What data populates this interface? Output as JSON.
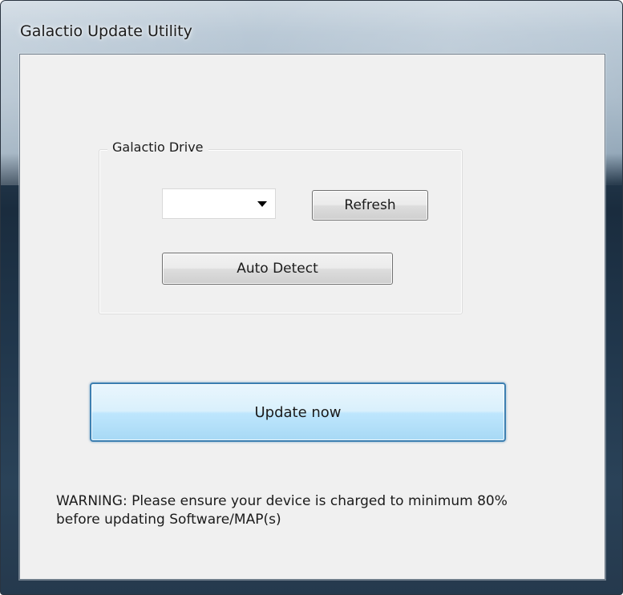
{
  "window": {
    "title": "Galactio Update Utility"
  },
  "drive_group": {
    "legend": "Galactio Drive",
    "drive_select": {
      "selected_value": "",
      "arrow_icon": "chevron-down-icon"
    },
    "refresh_label": "Refresh",
    "auto_detect_label": "Auto Detect"
  },
  "update_button": {
    "label": "Update now",
    "accent_color": "#3c7fb1"
  },
  "warning": {
    "line1": "WARNING: Please ensure your device is charged to minimum 80%",
    "line2": "before updating Software/MAP(s)"
  }
}
